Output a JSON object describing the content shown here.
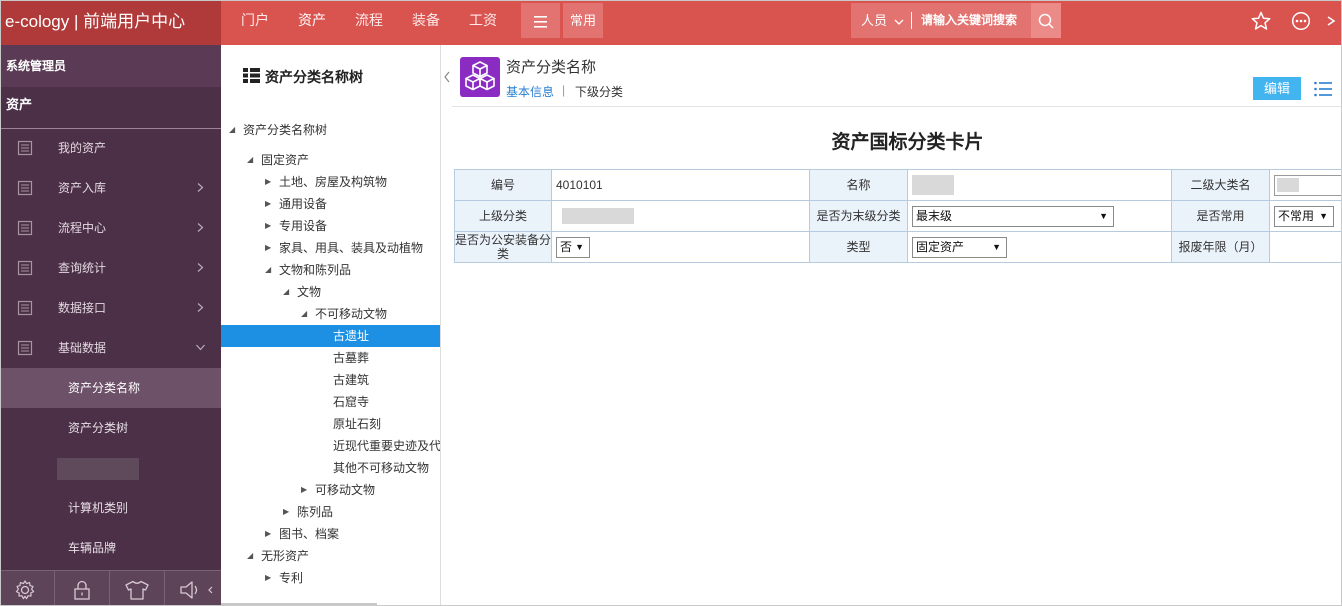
{
  "brand": "e-cology | 前端用户中心",
  "topnav": {
    "items": [
      "门户",
      "资产",
      "流程",
      "装备",
      "工资"
    ],
    "active": "资产",
    "common_label": "常用",
    "scope_label": "人员",
    "search_placeholder": "请输入关键词搜索"
  },
  "colors": {
    "topbar": "#d9534f",
    "brand_bg": "#b03a3a",
    "sidebar": "#4b3047",
    "accent": "#1e90e4",
    "edit_button": "#42b4f0",
    "header_icon": "#8a2bc2"
  },
  "sidebar": {
    "user": "系统管理员",
    "section": "资产",
    "menu": [
      {
        "label": "我的资产",
        "icon": "document-icon",
        "arrow": ""
      },
      {
        "label": "资产入库",
        "icon": "document-icon",
        "arrow": "right"
      },
      {
        "label": "流程中心",
        "icon": "document-icon",
        "arrow": "right"
      },
      {
        "label": "查询统计",
        "icon": "document-icon",
        "arrow": "right"
      },
      {
        "label": "数据接口",
        "icon": "document-icon",
        "arrow": "right"
      },
      {
        "label": "基础数据",
        "icon": "document-icon",
        "arrow": "down"
      }
    ],
    "submenu": [
      "资产分类名称",
      "资产分类树",
      "",
      "计算机类别",
      "车辆品牌"
    ],
    "active_submenu": "资产分类名称",
    "bottom_icons": [
      "gear-icon",
      "lock-icon",
      "shirt-icon",
      "speaker-icon"
    ]
  },
  "tree": {
    "title": "资产分类名称树",
    "nodes": [
      {
        "label": "资产分类名称树",
        "depth": 0,
        "state": "open"
      },
      {
        "label": "固定资产",
        "depth": 1,
        "state": "open"
      },
      {
        "label": "土地、房屋及构筑物",
        "depth": 2,
        "state": "closed"
      },
      {
        "label": "通用设备",
        "depth": 2,
        "state": "closed"
      },
      {
        "label": "专用设备",
        "depth": 2,
        "state": "closed"
      },
      {
        "label": "家具、用具、装具及动植物",
        "depth": 2,
        "state": "closed"
      },
      {
        "label": "文物和陈列品",
        "depth": 2,
        "state": "open"
      },
      {
        "label": "文物",
        "depth": 3,
        "state": "open"
      },
      {
        "label": "不可移动文物",
        "depth": 4,
        "state": "open"
      },
      {
        "label": "古遗址",
        "depth": 5,
        "state": "leaf",
        "selected": true
      },
      {
        "label": "古墓葬",
        "depth": 5,
        "state": "leaf"
      },
      {
        "label": "古建筑",
        "depth": 5,
        "state": "leaf"
      },
      {
        "label": "石窟寺",
        "depth": 5,
        "state": "leaf"
      },
      {
        "label": "原址石刻",
        "depth": 5,
        "state": "leaf"
      },
      {
        "label": "近现代重要史迹及代",
        "depth": 5,
        "state": "leaf"
      },
      {
        "label": "其他不可移动文物",
        "depth": 5,
        "state": "leaf"
      },
      {
        "label": "可移动文物",
        "depth": 4,
        "state": "closed"
      },
      {
        "label": "陈列品",
        "depth": 3,
        "state": "closed"
      },
      {
        "label": "图书、档案",
        "depth": 2,
        "state": "closed"
      },
      {
        "label": "无形资产",
        "depth": 1,
        "state": "open"
      },
      {
        "label": "专利",
        "depth": 2,
        "state": "closed"
      }
    ]
  },
  "content": {
    "title": "资产分类名称",
    "tabs": [
      "基本信息",
      "下级分类"
    ],
    "tab_separator": "|",
    "edit_label": "编辑",
    "card_title": "资产国标分类卡片",
    "form": {
      "code_label": "编号",
      "code_value": "4010101",
      "name_label": "名称",
      "category_label": "二级大类名",
      "parent_label": "上级分类",
      "is_leaf_label": "是否为末级分类",
      "is_leaf_value": "最末级",
      "common_label": "是否常用",
      "common_value": "不常用",
      "police_label": "是否为公安装备分类",
      "police_value": "否",
      "type_label": "类型",
      "type_value": "固定资产",
      "scrap_label": "报废年限（月）"
    }
  }
}
